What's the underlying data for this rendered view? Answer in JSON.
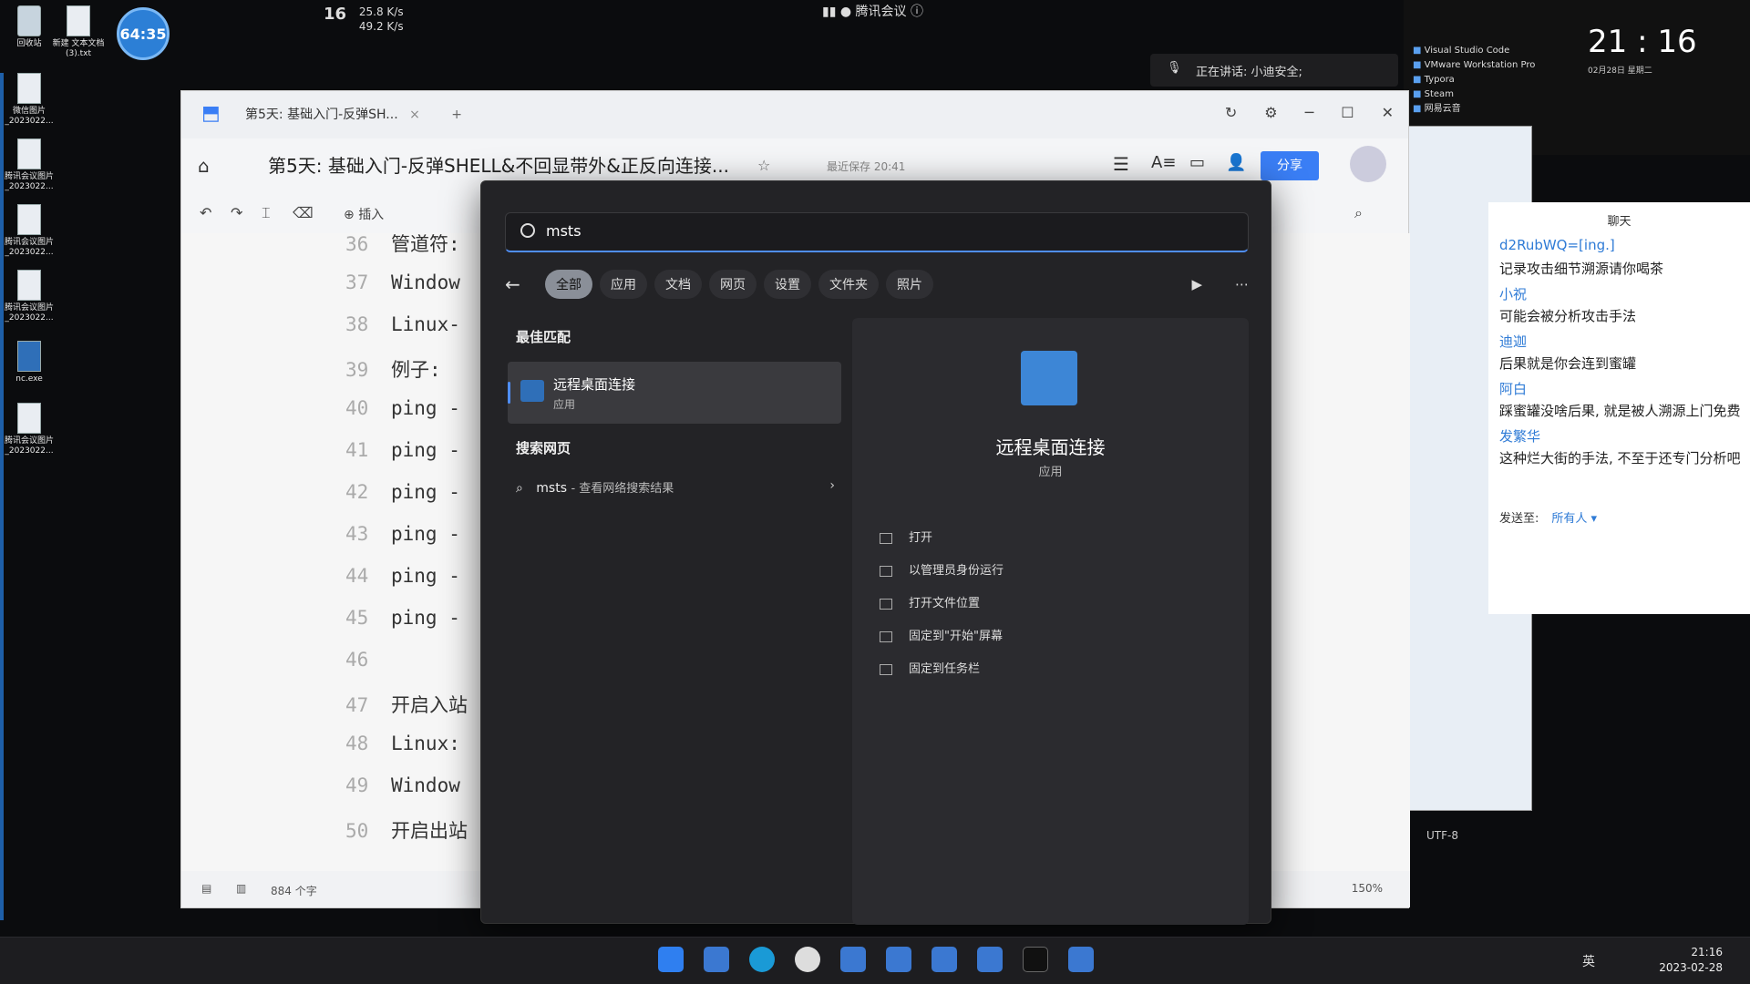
{
  "desktop": {
    "icons": [
      {
        "label": "回收站"
      },
      {
        "label": "新建 文本文档 (3).txt"
      },
      {
        "label": "微信图片_2023022..."
      },
      {
        "label": "腾讯会议图片_2023022..."
      },
      {
        "label": "腾讯会议图片_2023022..."
      },
      {
        "label": "腾讯会议图片_2023022..."
      },
      {
        "label": "nc.exe"
      },
      {
        "label": "腾讯会议图片_2023022..."
      }
    ],
    "timer": "64:35"
  },
  "top_status": {
    "net_percent": "16",
    "net_up": "25.8 K/s",
    "net_down": "49.2 K/s",
    "meeting": "腾讯会议",
    "speaking": "正在讲话: 小迪安全;"
  },
  "clock": {
    "time": "21 : 16",
    "date": "02月28日  星期二"
  },
  "app_list": [
    "Visual Studio Code",
    "VMware Workstation Pro",
    "Typora",
    "Steam",
    "网易云音"
  ],
  "editor_window": {
    "tab_label": "第5天: 基础入门-反弹SH...",
    "doc_title": "第5天: 基础入门-反弹SHELL&不回显带外&正反向连接...",
    "saved_text": "最近保存 20:41",
    "share_label": "分享",
    "insert_label": "插入",
    "lines": [
      {
        "num": "36",
        "text": "管道符:"
      },
      {
        "num": "37",
        "text": "Window"
      },
      {
        "num": "38",
        "text": "Linux-"
      },
      {
        "num": "39",
        "text": "例子:"
      },
      {
        "num": "40",
        "text": "ping -"
      },
      {
        "num": "41",
        "text": "ping -"
      },
      {
        "num": "42",
        "text": "ping -"
      },
      {
        "num": "43",
        "text": "ping -"
      },
      {
        "num": "44",
        "text": "ping -"
      },
      {
        "num": "45",
        "text": "ping -"
      },
      {
        "num": "46",
        "text": ""
      },
      {
        "num": "47",
        "text": "开启入站"
      },
      {
        "num": "48",
        "text": "Linux:"
      },
      {
        "num": "49",
        "text": "Window"
      },
      {
        "num": "50",
        "text": "开启出站"
      }
    ],
    "word_count": "884 个字",
    "zoom": "150%"
  },
  "search": {
    "query": "msts",
    "filters": [
      "全部",
      "应用",
      "文档",
      "网页",
      "设置",
      "文件夹",
      "照片"
    ],
    "best_match_label": "最佳匹配",
    "best_match": {
      "name": "远程桌面连接",
      "kind": "应用"
    },
    "web_label": "搜索网页",
    "web_query": "msts",
    "web_suffix": " - 查看网络搜索结果",
    "preview": {
      "name": "远程桌面连接",
      "kind": "应用"
    },
    "actions": [
      "打开",
      "以管理员身份运行",
      "打开文件位置",
      "固定到\"开始\"屏幕",
      "固定到任务栏"
    ]
  },
  "chat": {
    "title": "聊天",
    "messages": [
      {
        "name": "d2RubWQ=[ing.]",
        "text": "记录攻击细节溯源请你喝茶"
      },
      {
        "name": "小祝",
        "text": "可能会被分析攻击手法"
      },
      {
        "name": "迪迦",
        "text": "后果就是你会连到蜜罐"
      },
      {
        "name": "阿白",
        "text": "踩蜜罐没啥后果, 就是被人溯源上门免费"
      },
      {
        "name": "发繁华",
        "text": "这种烂大街的手法, 不至于还专门分析吧"
      }
    ],
    "send_to_label": "发送至:",
    "send_to_value": "所有人 ▾"
  },
  "notepad": {
    "encoding": "UTF-8"
  },
  "taskbar": {
    "tray_lang": "英",
    "time": "21:16",
    "date": "2023-02-28"
  }
}
